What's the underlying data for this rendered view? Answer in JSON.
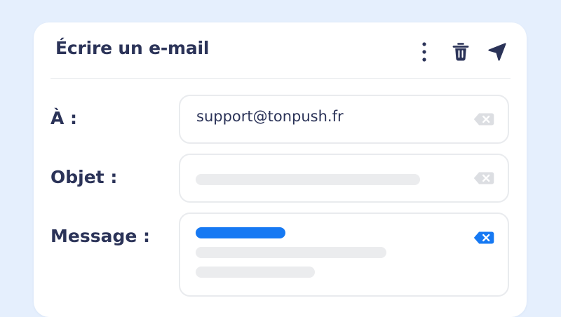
{
  "composer": {
    "title": "Écrire un e-mail",
    "icons": {
      "more": "more-vertical-icon",
      "delete": "trash-icon",
      "send": "send-icon"
    }
  },
  "fields": {
    "to": {
      "label": "À :",
      "value": "support@tonpush.fr"
    },
    "subject": {
      "label": "Objet :",
      "value": ""
    },
    "message": {
      "label": "Message :",
      "value": ""
    }
  },
  "colors": {
    "background": "#e5effd",
    "text": "#2b3358",
    "accent": "#1679f3",
    "placeholder": "#ebecee",
    "clear_inactive": "#dcdee2"
  }
}
